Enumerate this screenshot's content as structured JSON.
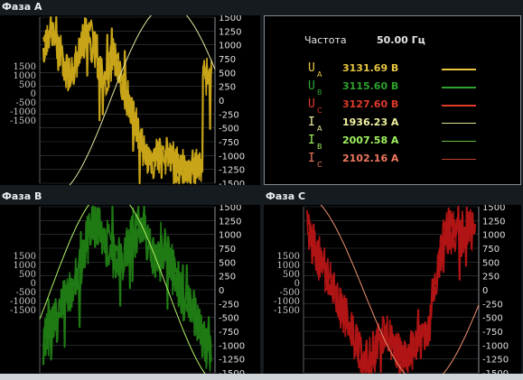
{
  "panels": {
    "a": {
      "title": "Фаза A",
      "trace_color": "#c8a418",
      "sine_color": "#e6e6a0"
    },
    "b": {
      "title": "Фаза B",
      "trace_color": "#1f7a14",
      "sine_color": "#b4f064"
    },
    "c": {
      "title": "Фаза C",
      "trace_color": "#b01414",
      "sine_color": "#f09070"
    }
  },
  "left_ticks": [
    "1500",
    "1000",
    "500",
    "0",
    "-500",
    "-1000",
    "-1500"
  ],
  "right_ticks": [
    "1500",
    "1250",
    "1000",
    "750",
    "500",
    "250",
    "0",
    "-250",
    "-500",
    "-750",
    "-1000",
    "-1250",
    "-1500"
  ],
  "info": {
    "frequency_label": "Частота",
    "frequency_value": "50.00 Гц",
    "rows": [
      {
        "symbol": "U",
        "sub": "A",
        "value": "3131.69 В",
        "color": "#e8c640",
        "line_color": "#e8c640",
        "line_width": 2
      },
      {
        "symbol": "U",
        "sub": "B",
        "value": "3115.60 В",
        "color": "#2ea22e",
        "line_color": "#2ea22e",
        "line_width": 2
      },
      {
        "symbol": "U",
        "sub": "C",
        "value": "3127.60 В",
        "color": "#e03a2a",
        "line_color": "#e03a2a",
        "line_width": 2
      },
      {
        "symbol": "I",
        "sub": "A",
        "value": "1936.23 А",
        "color": "#f0f0a0",
        "line_color": "#e0e090",
        "line_width": 1
      },
      {
        "symbol": "I",
        "sub": "B",
        "value": "2007.58 А",
        "color": "#a0f060",
        "line_color": "#60c040",
        "line_width": 1
      },
      {
        "symbol": "I",
        "sub": "C",
        "value": "2102.16 А",
        "color": "#f07860",
        "line_color": "#c04030",
        "line_width": 1
      }
    ]
  }
}
